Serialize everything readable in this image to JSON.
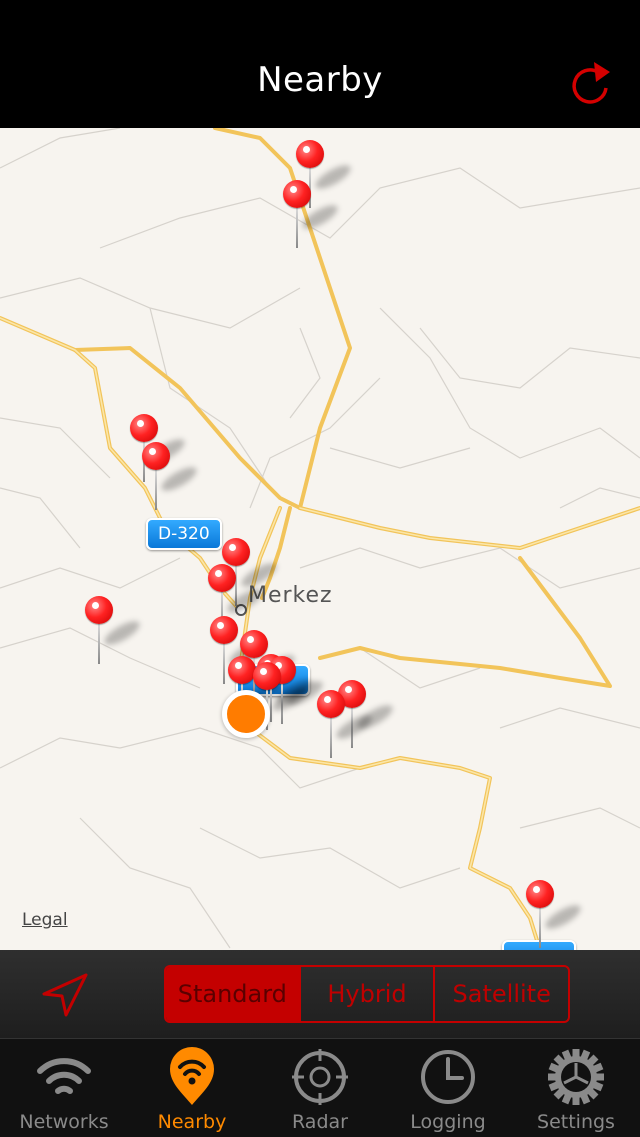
{
  "header": {
    "title": "Nearby",
    "refresh_icon": "refresh-icon"
  },
  "map": {
    "legal": "Legal",
    "city_label": "Merkez",
    "road_badges": [
      "D-320",
      "D-320",
      ""
    ],
    "pin_count": 16
  },
  "map_modes": {
    "options": [
      "Standard",
      "Hybrid",
      "Satellite"
    ],
    "selected": "Standard"
  },
  "tabs": [
    {
      "label": "Networks",
      "icon": "wifi-icon"
    },
    {
      "label": "Nearby",
      "icon": "nearby-pin-icon",
      "active": true
    },
    {
      "label": "Radar",
      "icon": "radar-icon"
    },
    {
      "label": "Logging",
      "icon": "clock-icon"
    },
    {
      "label": "Settings",
      "icon": "gear-icon"
    }
  ],
  "colors": {
    "accent": "#c40000",
    "active_tab": "#ff8a00",
    "pin": "#ff2222",
    "road": "#f6c65a"
  }
}
